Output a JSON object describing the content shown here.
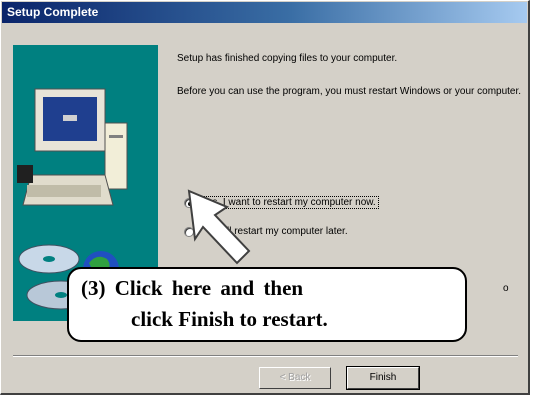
{
  "window": {
    "title": "Setup Complete"
  },
  "body": {
    "line1": "Setup has finished copying files to your computer.",
    "line2": "Before you can use the program, you must restart Windows or your computer."
  },
  "options": [
    {
      "label": "Yes, I want to restart my computer now.",
      "selected": true
    },
    {
      "label": "I will restart my computer later.",
      "selected": false
    }
  ],
  "callout": {
    "line1": "(3)  Click here and then",
    "line2": "click Finish to restart.",
    "tail_text": "o"
  },
  "buttons": {
    "back": "< Back",
    "finish": "Finish"
  }
}
